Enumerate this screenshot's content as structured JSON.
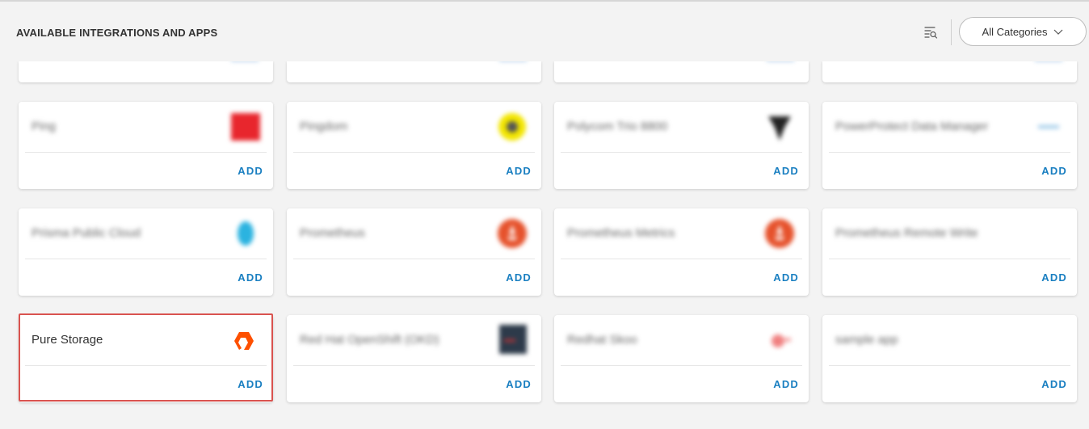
{
  "header": {
    "title": "AVAILABLE INTEGRATIONS AND APPS",
    "filter_icon": "filter-list-icon",
    "category_select": "All Categories"
  },
  "cards": [
    {
      "name": "",
      "logo": "logo-icon",
      "add": ""
    },
    {
      "name": "",
      "logo": "logo-icon",
      "add": ""
    },
    {
      "name": "",
      "logo": "logo-icon",
      "add": ""
    },
    {
      "name": "",
      "logo": "logo-icon",
      "add": ""
    },
    {
      "name": "Ping",
      "logo": "ping-logo-icon",
      "add": "ADD"
    },
    {
      "name": "Pingdom",
      "logo": "pingdom-logo-icon",
      "add": "ADD"
    },
    {
      "name": "Polycom Trio 8800",
      "logo": "polycom-logo-icon",
      "add": "ADD"
    },
    {
      "name": "PowerProtect Data Manager",
      "logo": "powerprotect-logo-icon",
      "add": "ADD"
    },
    {
      "name": "Prisma Public Cloud",
      "logo": "prisma-logo-icon",
      "add": "ADD"
    },
    {
      "name": "Prometheus",
      "logo": "prometheus-logo-icon",
      "add": "ADD"
    },
    {
      "name": "Prometheus Metrics",
      "logo": "prometheus-logo-icon",
      "add": "ADD"
    },
    {
      "name": "Prometheus Remote Write",
      "logo": "prometheus-remote-logo-icon",
      "add": "ADD"
    },
    {
      "name": "Pure Storage",
      "logo": "pure-storage-logo-icon",
      "add": "ADD"
    },
    {
      "name": "Red Hat OpenShift (OKD)",
      "logo": "openshift-logo-icon",
      "add": "ADD"
    },
    {
      "name": "Redhat Skoo",
      "logo": "redhat-logo-icon",
      "add": "ADD"
    },
    {
      "name": "sample app",
      "logo": "app-logo-icon",
      "add": "ADD"
    }
  ],
  "colors": {
    "accent": "#1a7fc1",
    "highlight": "#d9534f",
    "ping": "#e8262d",
    "pingdom": "#f3e600",
    "prometheus": "#e6522c",
    "pure": "#fe5000",
    "prisma": "#2bb3e0",
    "openshift": "#2d3a4a",
    "polycom": "#222222"
  }
}
